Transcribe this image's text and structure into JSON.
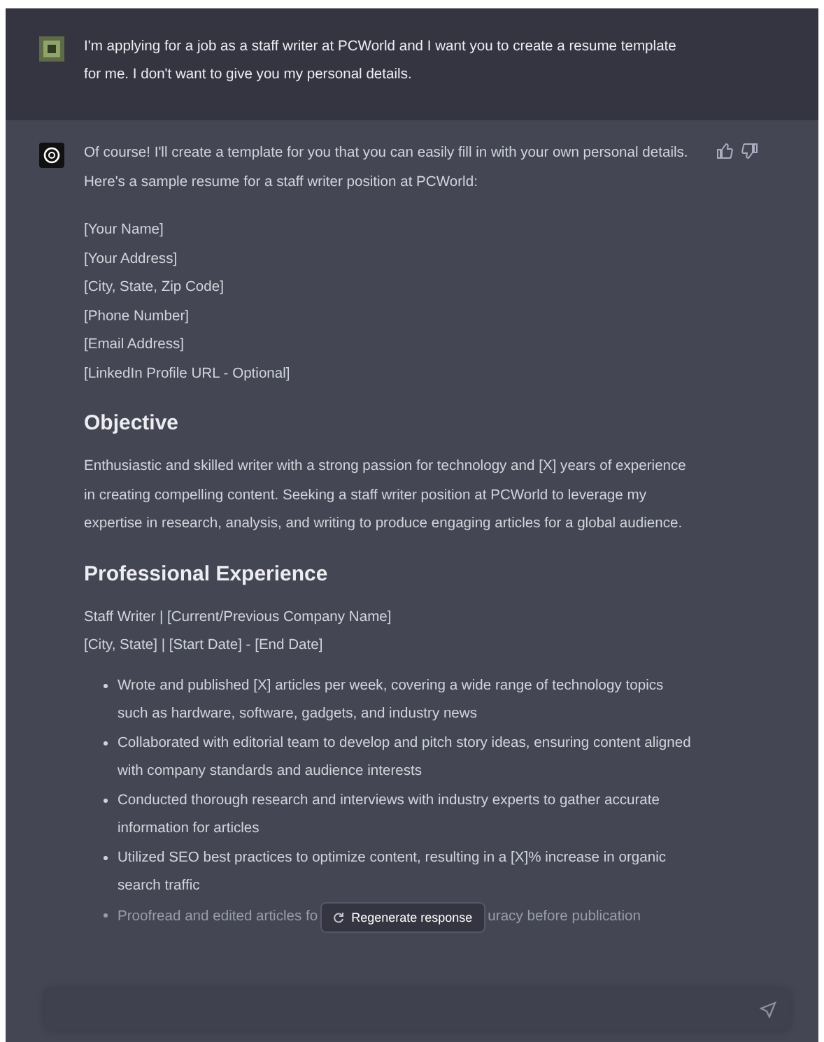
{
  "user_message": {
    "text": "I'm applying for a job as a staff writer at PCWorld and I want you to create a resume template for me. I don't want to give you my personal details."
  },
  "assistant_message": {
    "intro": "Of course! I'll create a template for you that you can easily fill in with your own personal details. Here's a sample resume for a staff writer position at PCWorld:",
    "contact_lines": [
      "[Your Name]",
      "[Your Address]",
      "[City, State, Zip Code]",
      "[Phone Number]",
      "[Email Address]",
      "[LinkedIn Profile URL - Optional]"
    ],
    "sections": [
      {
        "heading": "Objective",
        "lines": [
          "Enthusiastic and skilled writer with a strong passion for technology and [X] years of experience in creating compelling content. Seeking a staff writer position at PCWorld to leverage my expertise in research, analysis, and writing to produce engaging articles for a global audience."
        ]
      },
      {
        "heading": "Professional Experience",
        "lines": [
          "Staff Writer | [Current/Previous Company Name]",
          "[City, State] | [Start Date] - [End Date]"
        ],
        "bullets": [
          {
            "kind": "full",
            "text": "Wrote and published [X] articles per week, covering a wide range of technology topics such as hardware, software, gadgets, and industry news"
          },
          {
            "kind": "full",
            "text": "Collaborated with editorial team to develop and pitch story ideas, ensuring content aligned with company standards and audience interests"
          },
          {
            "kind": "full",
            "text": "Conducted thorough research and interviews with industry experts to gather accurate information for articles"
          },
          {
            "kind": "full",
            "text": "Utilized SEO best practices to optimize content, resulting in a [X]% increase in organic search traffic"
          },
          {
            "kind": "covered",
            "text_before": "Proofread and edited articles fo",
            "text_after": "uracy before publication"
          }
        ]
      }
    ]
  },
  "regenerate_button": {
    "label": "Regenerate response"
  }
}
